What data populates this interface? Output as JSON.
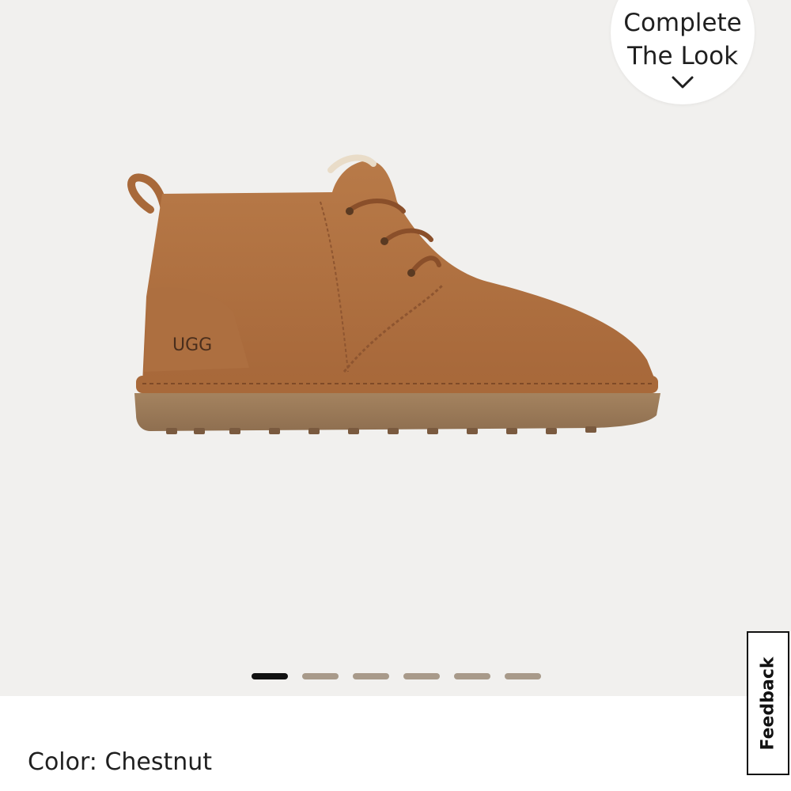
{
  "gallery": {
    "image_alt": "Chestnut suede chukka boot",
    "logo_text": "UGG",
    "slide_count": 6,
    "active_slide": 1,
    "colors": {
      "background": "#f1f0ee",
      "active_dot": "#111111",
      "inactive_dot": "#a89a8a",
      "boot_suede": "#b0703e",
      "boot_sole": "#9d7a5a"
    }
  },
  "complete_the_look": {
    "line1": "Complete",
    "line2": "The Look",
    "icon": "chevron-down-icon"
  },
  "product": {
    "color_label": "Color: Chestnut"
  },
  "feedback": {
    "label": "Feedback"
  }
}
